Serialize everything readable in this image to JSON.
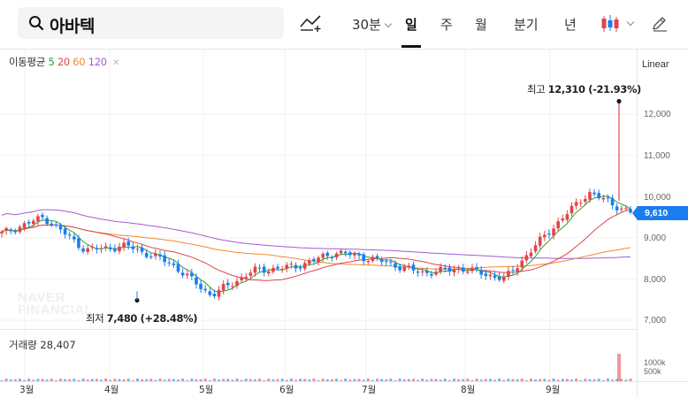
{
  "search": {
    "query": "아바텍"
  },
  "toolbar": {
    "periods": [
      {
        "label": "30분",
        "has_dropdown": true,
        "active": false
      },
      {
        "label": "일",
        "has_dropdown": false,
        "active": true
      },
      {
        "label": "주",
        "has_dropdown": false,
        "active": false
      },
      {
        "label": "월",
        "has_dropdown": false,
        "active": false
      },
      {
        "label": "분기",
        "has_dropdown": false,
        "active": false
      },
      {
        "label": "년",
        "has_dropdown": false,
        "active": false
      }
    ],
    "icons": [
      "search-icon",
      "draw-indicator-icon",
      "candlestick-type-icon",
      "pencil-icon"
    ]
  },
  "chart": {
    "ma_legend": {
      "title": "이동평균",
      "periods": [
        "5",
        "20",
        "60",
        "120"
      ]
    },
    "scale_mode": "Linear",
    "y_ticks": [
      "12,000",
      "11,000",
      "10,000",
      "9,000",
      "8,000",
      "7,000"
    ],
    "current_price": "9,610",
    "high_annotation": {
      "label": "최고",
      "value": "12,310 (-21.93%)"
    },
    "low_annotation": {
      "label": "최저",
      "value": "7,480 (+28.48%)"
    },
    "watermark": [
      "NAVER",
      "FINANCIAL"
    ],
    "x_ticks": [
      "3월",
      "4월",
      "5월",
      "6월",
      "7월",
      "8월",
      "9월"
    ],
    "volume": {
      "label": "거래량",
      "value": "28,407",
      "ticks": [
        "1000k",
        "500k"
      ]
    },
    "colors": {
      "up": "#e0454a",
      "down": "#1a7df0",
      "ma5": "#29a12f",
      "ma20": "#e0454a",
      "ma60": "#f08a2c",
      "ma120": "#a25bd4"
    }
  },
  "chart_data": {
    "type": "candlestick",
    "y_range": [
      6800,
      12800
    ],
    "x_categories": [
      "3월",
      "4월",
      "5월",
      "6월",
      "7월",
      "8월",
      "9월"
    ],
    "high": 12310,
    "low": 7480,
    "last_close": 9610,
    "close_by_period": [
      {
        "period": "late Feb",
        "close": 9100
      },
      {
        "period": "3월 start",
        "close": 9500
      },
      {
        "period": "3월 mid",
        "close": 8700
      },
      {
        "period": "3월 end",
        "close": 8800
      },
      {
        "period": "4월 start",
        "close": 8400
      },
      {
        "period": "4월 low",
        "close": 7600
      },
      {
        "period": "4월 end",
        "close": 8200
      },
      {
        "period": "5월 start",
        "close": 8300
      },
      {
        "period": "5월 mid",
        "close": 8650
      },
      {
        "period": "6월",
        "close": 8450
      },
      {
        "period": "7월",
        "close": 8150
      },
      {
        "period": "8월",
        "close": 8250
      },
      {
        "period": "9월 start",
        "close": 8000
      },
      {
        "period": "9월 mid",
        "close": 9100
      },
      {
        "period": "9월 peak",
        "close": 10100
      },
      {
        "period": "last",
        "close": 9610
      }
    ]
  }
}
